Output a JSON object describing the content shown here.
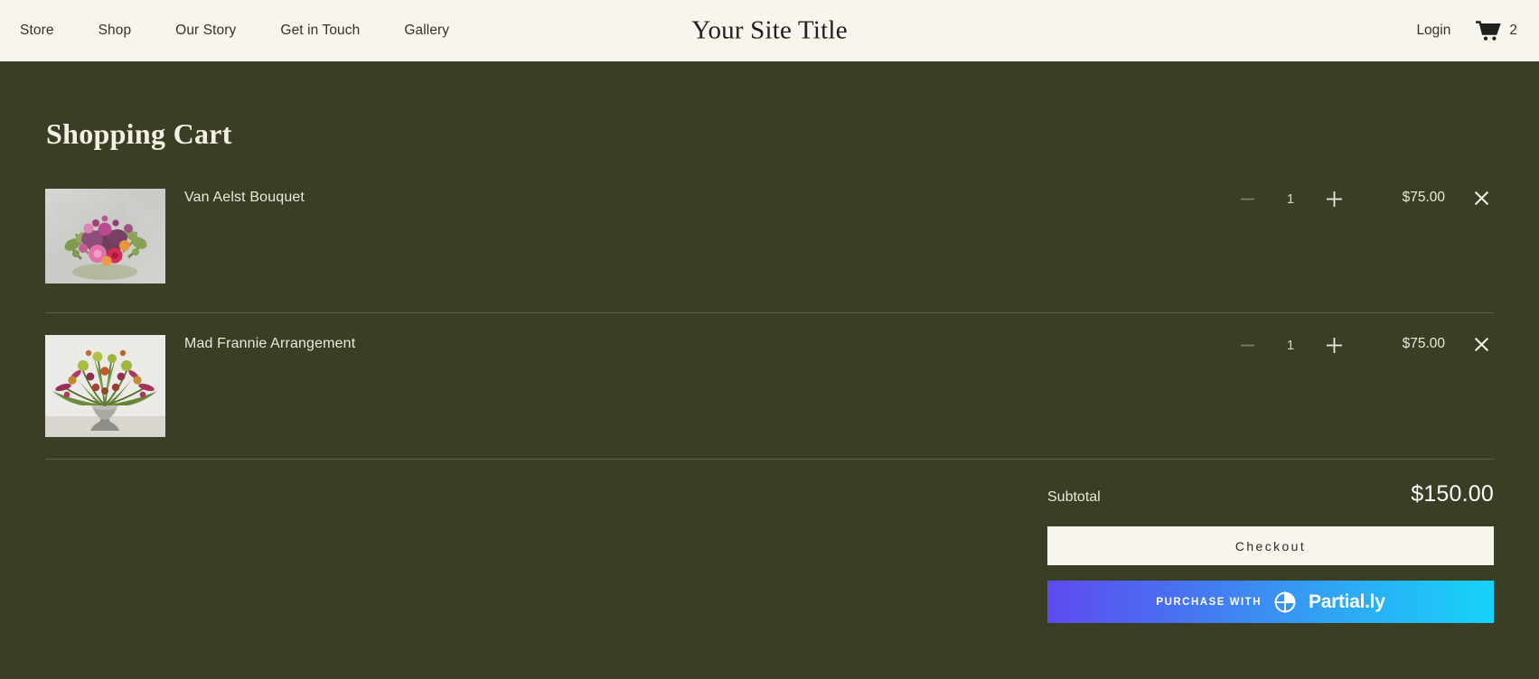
{
  "header": {
    "nav_items": [
      {
        "label": "Store",
        "name": "nav-store"
      },
      {
        "label": "Shop",
        "name": "nav-shop"
      },
      {
        "label": "Our Story",
        "name": "nav-our-story"
      },
      {
        "label": "Get in Touch",
        "name": "nav-get-in-touch"
      },
      {
        "label": "Gallery",
        "name": "nav-gallery"
      }
    ],
    "site_title": "Your Site Title",
    "login_label": "Login",
    "cart_count": "2",
    "cart_icon": "shopping-cart-icon",
    "background_color": "#f8f5ee",
    "text_color": "#33332e"
  },
  "page": {
    "title": "Shopping Cart",
    "background_color": "#3a3e24",
    "text_color": "#f2efe4",
    "divider_color": "#5d6048"
  },
  "cart": {
    "items": [
      {
        "name": "Van Aelst Bouquet",
        "quantity": "1",
        "price": "$75.00",
        "decrease_icon": "minus-icon",
        "increase_icon": "plus-icon",
        "remove_icon": "close-x-icon",
        "image_alt": "pink-bouquet-on-marble"
      },
      {
        "name": "Mad Frannie Arrangement",
        "quantity": "1",
        "price": "$75.00",
        "decrease_icon": "minus-icon",
        "increase_icon": "plus-icon",
        "remove_icon": "close-x-icon",
        "image_alt": "wild-arrangement-in-silver-vase"
      }
    ]
  },
  "summary": {
    "subtotal_label": "Subtotal",
    "subtotal_value": "$150.00",
    "checkout_label": "Checkout",
    "partially": {
      "prefix_label": "PURCHASE WITH",
      "wordmark": "Partial.ly",
      "logo_icon": "partially-circle-logo-icon",
      "gradient_start": "#5d4bf0",
      "gradient_end": "#16d3f8"
    }
  }
}
